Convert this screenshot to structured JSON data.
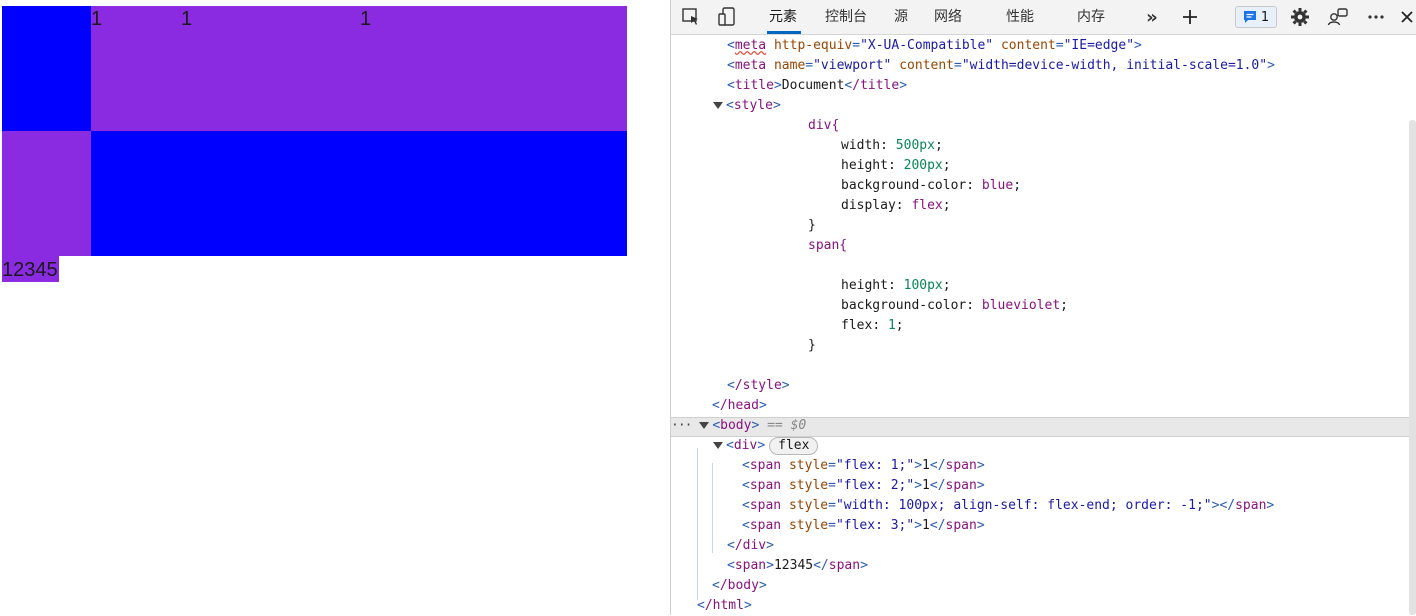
{
  "preview": {
    "flex_items": [
      "1",
      "1",
      "1"
    ],
    "outside_span": "12345",
    "colors": {
      "container": "#0000ff",
      "item": "#8a2be2"
    }
  },
  "devtools": {
    "tabs": [
      {
        "label": "元素",
        "active": true
      },
      {
        "label": "控制台"
      },
      {
        "label": "源"
      },
      {
        "label": "网络"
      },
      {
        "label": "性能"
      },
      {
        "label": "内存"
      }
    ],
    "issues_count": "1",
    "icons": [
      "inspect-icon",
      "device-toggle-icon",
      "more-tabs-icon",
      "add-tab-icon",
      "issues-icon",
      "settings-icon",
      "customize-icon",
      "more-options-icon",
      "close-icon"
    ],
    "code": {
      "meta1": {
        "tag": "meta",
        "attr1": "http-equiv",
        "val1": "\"X-UA-Compatible\"",
        "attr2": "content",
        "val2": "\"IE=edge\""
      },
      "meta2": {
        "tag": "meta",
        "attr1": "name",
        "val1": "\"viewport\"",
        "attr2": "content",
        "val2": "\"width=device-width, initial-scale=1.0\""
      },
      "title_open": "title",
      "title_text": "Document",
      "title_close": "/title",
      "style_open": "style",
      "css": {
        "div_sel": "div{",
        "div_props": [
          {
            "prop": "width",
            "val": "500px"
          },
          {
            "prop": "height",
            "val": "200px"
          },
          {
            "prop": "background-color",
            "val": "blue"
          },
          {
            "prop": "display",
            "val": "flex"
          }
        ],
        "close": "}",
        "span_sel": "span{",
        "span_props": [
          {
            "prop": "height",
            "val": "100px"
          },
          {
            "prop": "background-color",
            "val": "blueviolet"
          },
          {
            "prop": "flex",
            "val": "1"
          }
        ]
      },
      "style_close": "/style",
      "head_close": "/head",
      "body_open": "body",
      "body_marker": "== $0",
      "div_open": "div",
      "flex_badge": "flex",
      "spans": [
        {
          "style": "\"flex: 1;\"",
          "text": "1"
        },
        {
          "style": "\"flex: 2;\"",
          "text": "1"
        },
        {
          "style": "\"width: 100px; align-self: flex-end; order: -1;\"",
          "text": ""
        },
        {
          "style": "\"flex: 3;\"",
          "text": "1"
        }
      ],
      "div_close": "/div",
      "outside_span_text": "12345",
      "body_close": "/body",
      "html_close": "/html"
    }
  }
}
